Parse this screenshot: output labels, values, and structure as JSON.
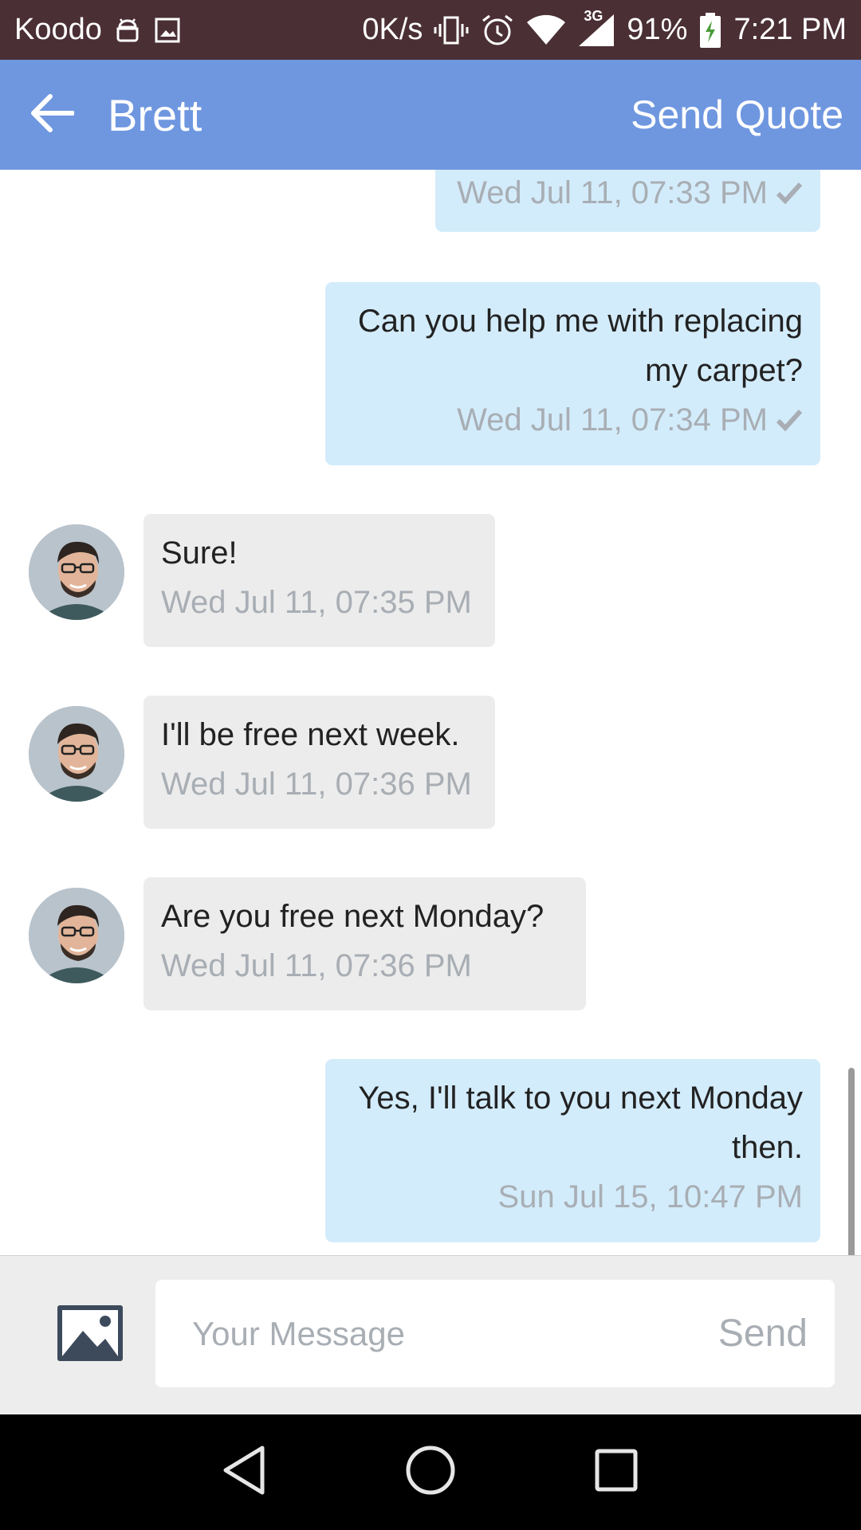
{
  "status_bar": {
    "carrier": "Koodo",
    "network_speed": "0K/s",
    "network_type": "3G",
    "battery": "91%",
    "time": "7:21 PM"
  },
  "header": {
    "title": "Brett",
    "send_quote": "Send Quote"
  },
  "messages": [
    {
      "direction": "outgoing",
      "text": "",
      "time": "Wed Jul 11, 07:33 PM",
      "read_check": true
    },
    {
      "direction": "outgoing",
      "text": "Can you help me with replacing my carpet?",
      "time": "Wed Jul 11, 07:34 PM",
      "read_check": true
    },
    {
      "direction": "incoming",
      "text": "Sure!",
      "time": "Wed Jul 11, 07:35 PM"
    },
    {
      "direction": "incoming",
      "text": "I'll be free next week.",
      "time": "Wed Jul 11, 07:36 PM"
    },
    {
      "direction": "incoming",
      "text": "Are you free next Monday?",
      "time": "Wed Jul 11, 07:36 PM"
    },
    {
      "direction": "outgoing",
      "text": "Yes, I'll talk to you next Monday then.",
      "time": "Sun Jul 15, 10:47 PM"
    }
  ],
  "composer": {
    "placeholder": "Your Message",
    "value": "",
    "send_label": "Send"
  },
  "colors": {
    "status_bar": "#4a2f35",
    "app_bar": "#6f97e0",
    "outgoing_bubble": "#d3ecfb",
    "incoming_bubble": "#ececec",
    "timestamp": "#a8aeb4"
  },
  "icons": [
    "back-arrow-icon",
    "image-icon",
    "nav-back-icon",
    "nav-home-icon",
    "nav-recents-icon"
  ]
}
